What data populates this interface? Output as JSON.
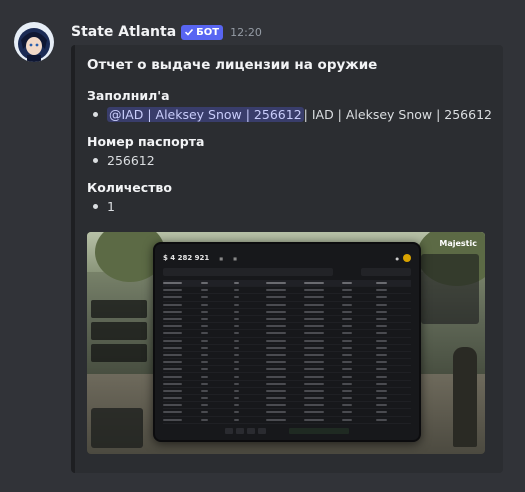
{
  "author": {
    "name": "State Atlanta",
    "bot_badge": "БОТ",
    "time": "12:20"
  },
  "embed": {
    "title": "Отчет о выдаче лицензии на оружие",
    "fields": [
      {
        "name": "Заполнил'а",
        "mention": "@IAD | Aleksey Snow | 256612",
        "text": " | IAD | Aleksey Snow | 256612"
      },
      {
        "name": "Номер паспорта",
        "value": "256612"
      },
      {
        "name": "Количество",
        "value": "1"
      }
    ]
  },
  "screenshot": {
    "balance": "$ 4 282 921",
    "brand": "Majestic"
  },
  "colors": {
    "background": "#313338",
    "embed_bg": "#2b2d31",
    "bot_badge": "#5865f2",
    "mention_text": "#c9cdfb"
  }
}
